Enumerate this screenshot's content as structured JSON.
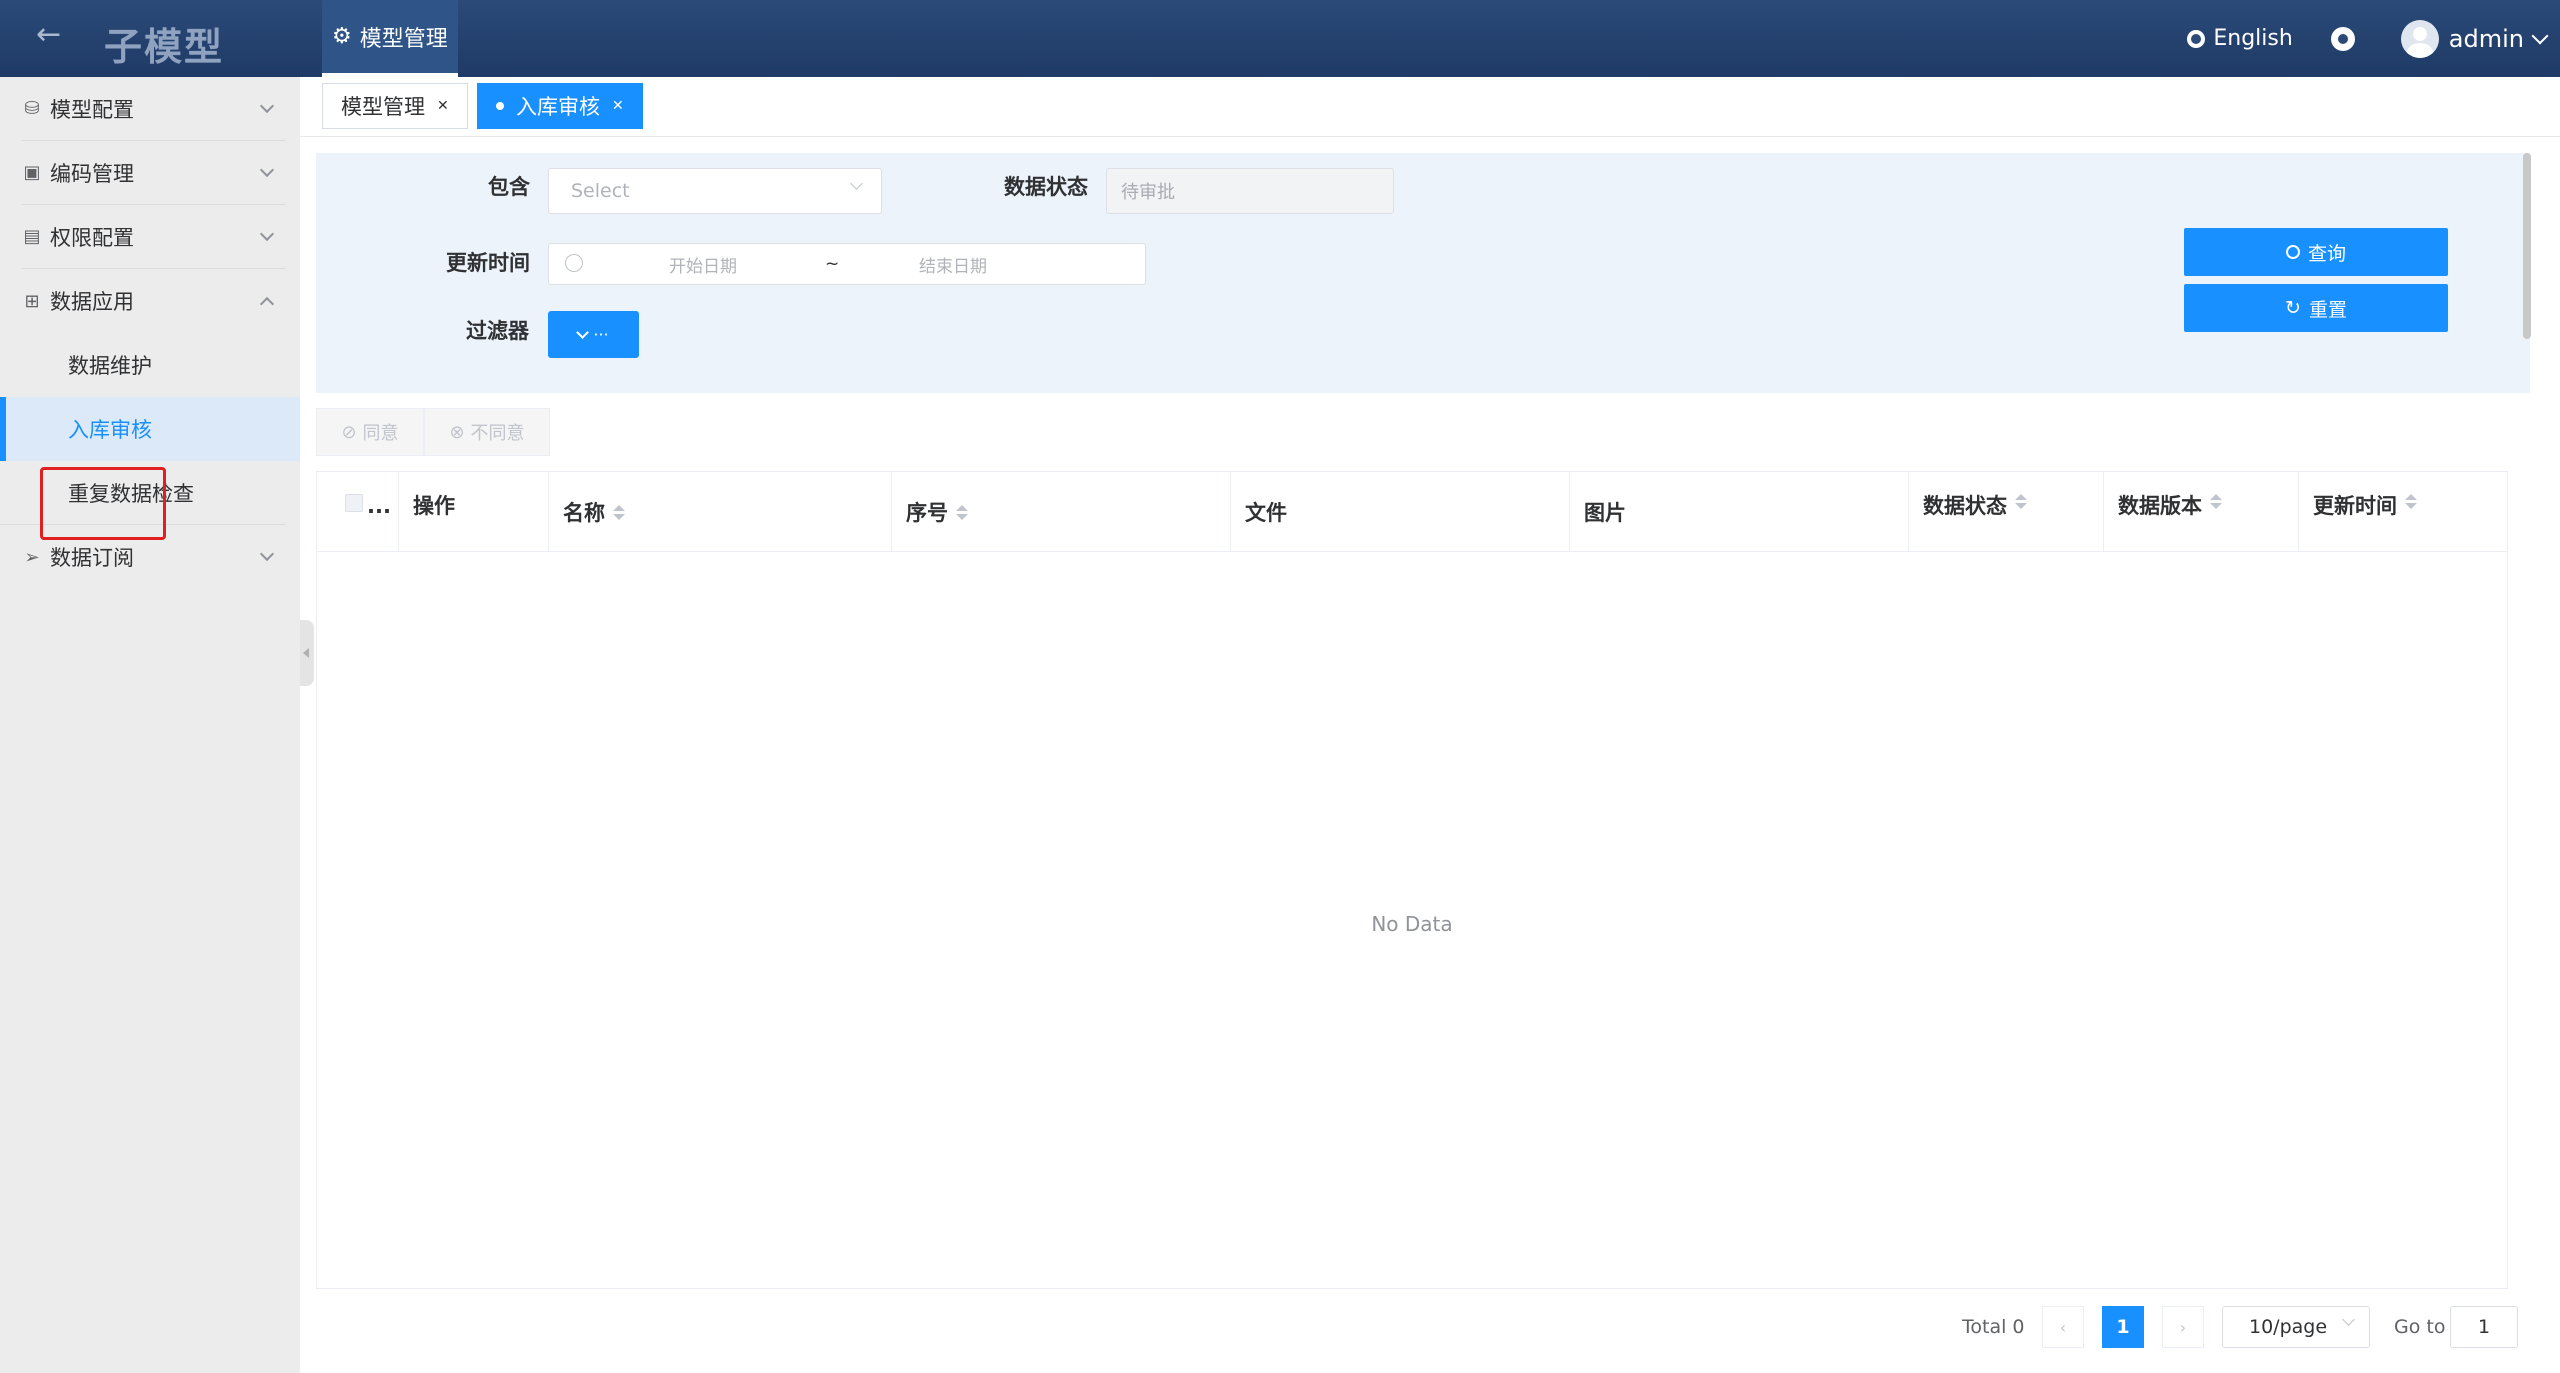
{
  "header": {
    "logo": "子模型",
    "top_tab": "模型管理",
    "language": "English",
    "user": "admin"
  },
  "sidebar": {
    "items": [
      {
        "label": "模型配置",
        "icon": "database-icon"
      },
      {
        "label": "编码管理",
        "icon": "chart-icon"
      },
      {
        "label": "权限配置",
        "icon": "doc-icon"
      },
      {
        "label": "数据应用",
        "icon": "grid-icon"
      },
      {
        "label": "数据订阅",
        "icon": "send-icon"
      }
    ],
    "sub_items": [
      {
        "label": "数据维护"
      },
      {
        "label": "入库审核"
      },
      {
        "label": "重复数据检查"
      }
    ]
  },
  "tabs": [
    {
      "label": "模型管理"
    },
    {
      "label": "入库审核"
    }
  ],
  "filter": {
    "contains_label": "包含",
    "contains_placeholder": "Select",
    "status_label": "数据状态",
    "status_value": "待审批",
    "time_label": "更新时间",
    "start_placeholder": "开始日期",
    "range_sep": "~",
    "end_placeholder": "结束日期",
    "filter_label": "过滤器",
    "filter_btn": "···",
    "query_btn": "查询",
    "reset_btn": "重置"
  },
  "actions": {
    "agree": "同意",
    "disagree": "不同意"
  },
  "table": {
    "columns": [
      "...",
      "操作",
      "名称",
      "序号",
      "文件",
      "图片",
      "数据状态",
      "数据版本",
      "更新时间"
    ],
    "empty_text": "No Data"
  },
  "pagination": {
    "total": "Total 0",
    "current_page": "1",
    "page_size": "10/page",
    "goto_label": "Go to",
    "goto_value": "1"
  },
  "colors": {
    "header_bg": "#2b4a78",
    "accent": "#1890ff",
    "highlight_border": "#e02020"
  }
}
